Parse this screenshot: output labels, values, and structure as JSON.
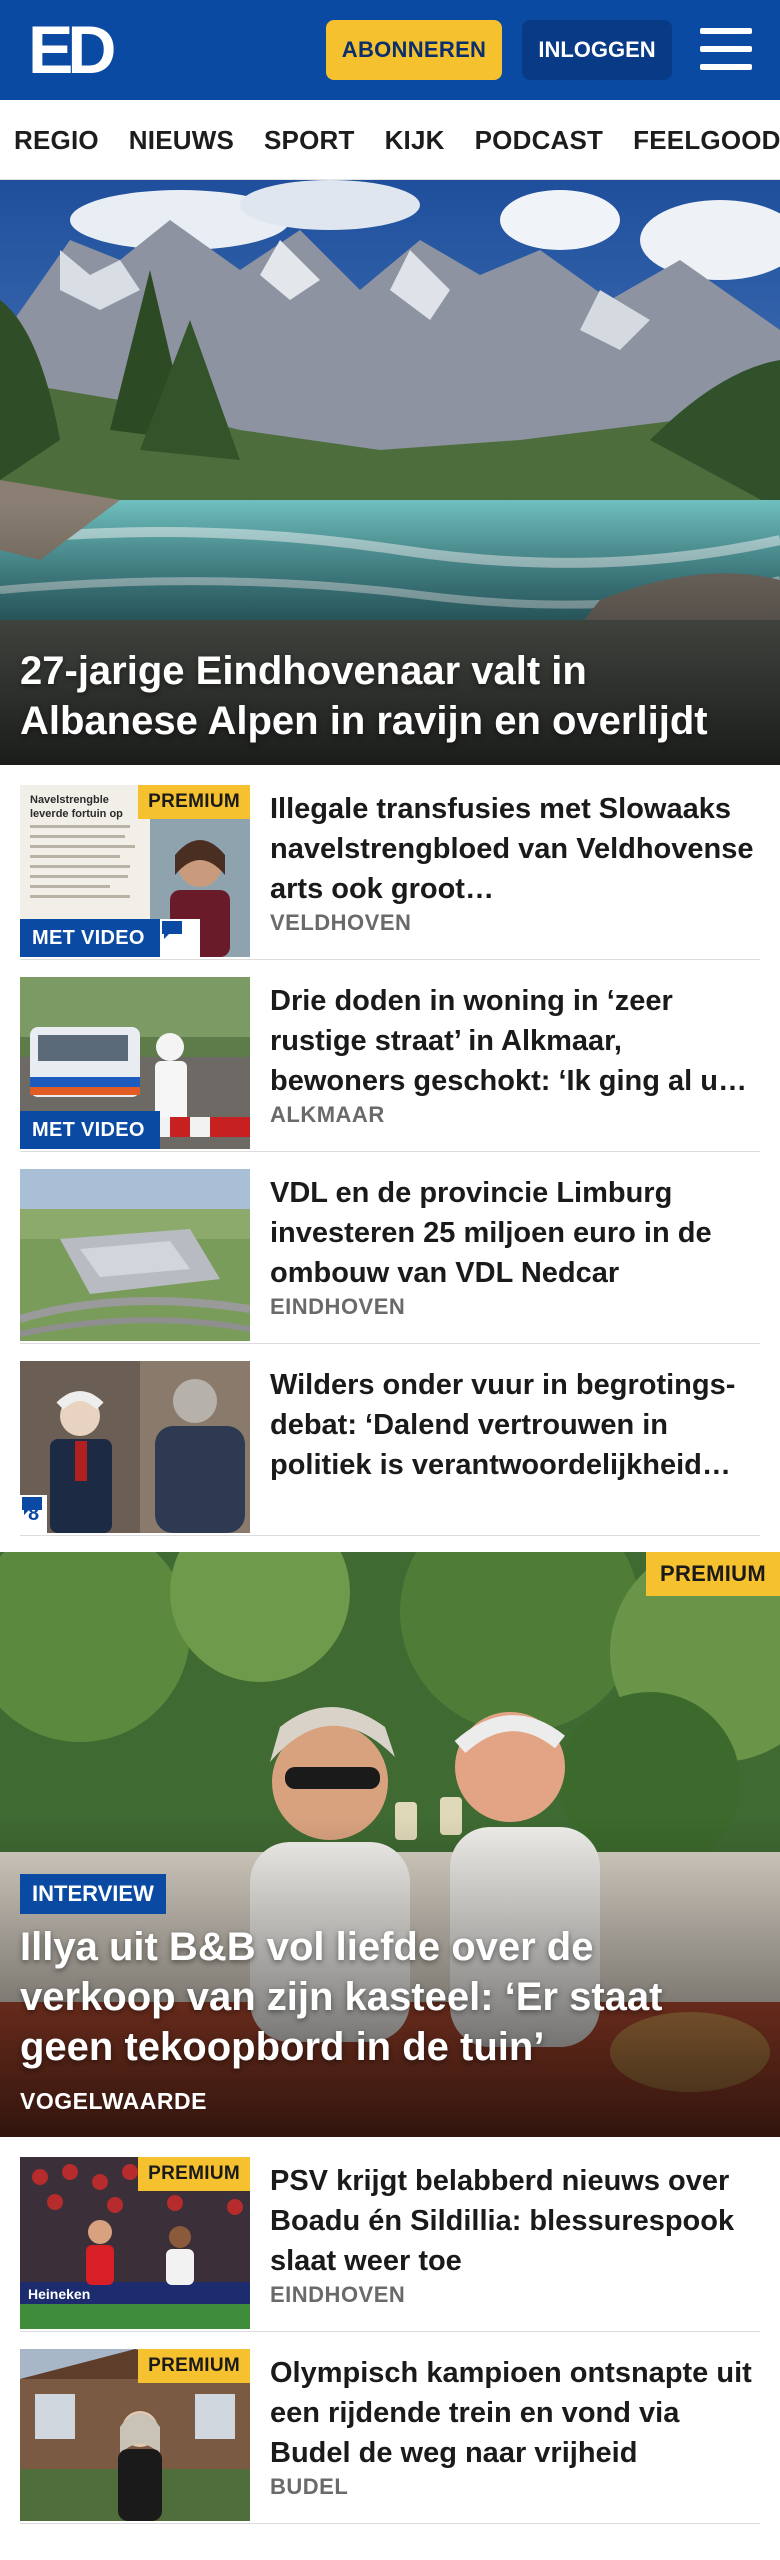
{
  "header": {
    "logo_text": "ED",
    "subscribe_label": "ABONNEREN",
    "login_label": "INLOGGEN",
    "menu_icon": "hamburger-menu-icon",
    "colors": {
      "brand_blue": "#0b4aa2",
      "accent_yellow": "#f6c12f"
    }
  },
  "nav": {
    "items": [
      "REGIO",
      "NIEUWS",
      "SPORT",
      "KIJK",
      "PODCAST",
      "FEELGOOD"
    ]
  },
  "hero": {
    "title": "27-jarige Eindhovenaar valt in Albanese Alpen in ravijn en overlijdt"
  },
  "articles": [
    {
      "title": "Illegale transfusies met Slowaaks navelstrengbloed van Veldhovense arts ook groot…",
      "location": "VELDHOVEN",
      "premium": "PREMIUM",
      "video": "MET VIDEO",
      "comment_icon": "comment-icon",
      "thumb_caption_lines": [
        "Navelstrengble",
        "leverde fortuin op"
      ]
    },
    {
      "title": "Drie doden in woning in ‘zeer rustige straat’ in Alkmaar, bewoners geschokt: ‘Ik ging al u…",
      "location": "ALKMAAR",
      "video": "MET VIDEO"
    },
    {
      "title": "VDL en de provincie Limburg investeren 25 miljoen euro in de ombouw van VDL Nedcar",
      "location": "EINDHOVEN"
    },
    {
      "title": "Wilders onder vuur in begrotings- debat: ‘Dalend vertrouwen in politiek is verantwoordelijkheid…",
      "comments": "8",
      "comment_icon": "comment-icon"
    }
  ],
  "feature": {
    "premium": "PREMIUM",
    "label": "INTERVIEW",
    "title": "Illya uit B&B vol liefde over de verkoop van zijn kasteel: ‘Er staat geen tekoopbord in de tuin’",
    "location": "VOGELWAARDE"
  },
  "more_articles": [
    {
      "title": "PSV krijgt belabberd nieuws over Boadu én Sildillia: blessurespook slaat weer toe",
      "location": "EINDHOVEN",
      "premium": "PREMIUM",
      "thumb_text": "Heineken"
    },
    {
      "title": "Olympisch kampioen ontsnapte uit een rijdende trein en vond via Budel de weg naar vrijheid",
      "location": "BUDEL",
      "premium": "PREMIUM"
    }
  ]
}
